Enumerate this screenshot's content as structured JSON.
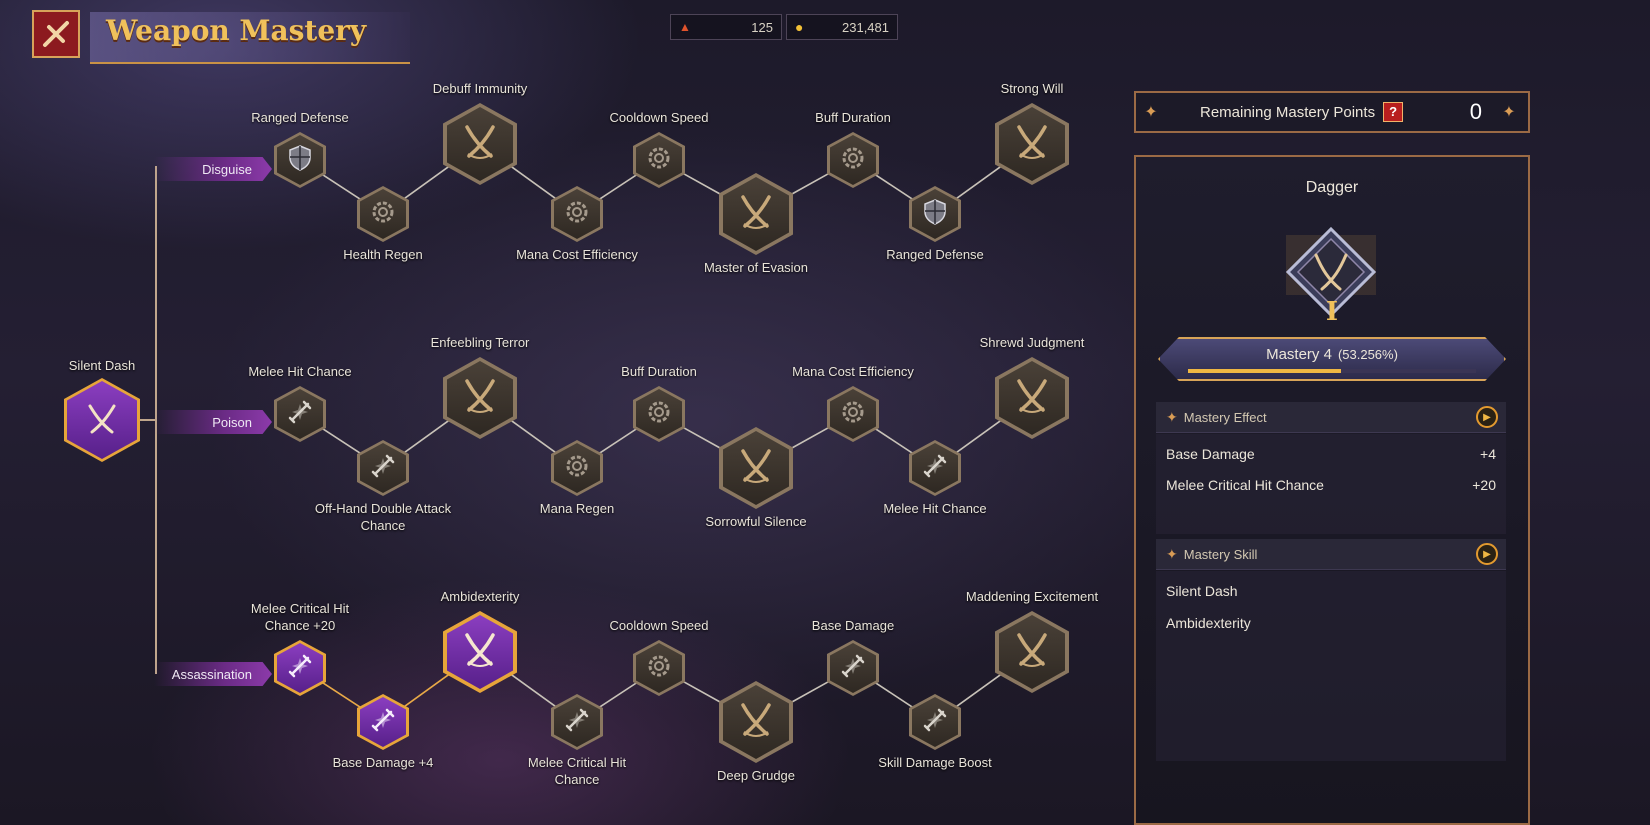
{
  "header": {
    "title": "Weapon Mastery"
  },
  "currencies": [
    {
      "icon": "ticket-icon",
      "value": "125"
    },
    {
      "icon": "gold-coin-icon",
      "value": "231,481"
    }
  ],
  "root": {
    "label": "Silent Dash"
  },
  "branches": [
    {
      "name": "Disguise",
      "nodes": [
        {
          "label": "Ranged Defense",
          "icon": "shield-icon"
        },
        {
          "label": "Health Regen",
          "icon": "gear-icon"
        },
        {
          "label": "Debuff Immunity",
          "icon": "crossed-daggers-icon"
        },
        {
          "label": "Mana Cost Efficiency",
          "icon": "gear-icon"
        },
        {
          "label": "Cooldown Speed",
          "icon": "gear-icon"
        },
        {
          "label": "Master of Evasion",
          "icon": "crossed-daggers-icon"
        },
        {
          "label": "Buff Duration",
          "icon": "gear-icon"
        },
        {
          "label": "Ranged Defense",
          "icon": "shield-icon"
        },
        {
          "label": "Strong Will",
          "icon": "crossed-daggers-icon"
        }
      ]
    },
    {
      "name": "Poison",
      "nodes": [
        {
          "label": "Melee Hit Chance",
          "icon": "sword-icon"
        },
        {
          "label": "Off-Hand Double Attack",
          "label2": "Chance",
          "icon": "sword-icon"
        },
        {
          "label": "Enfeebling Terror",
          "icon": "crossed-daggers-icon"
        },
        {
          "label": "Mana Regen",
          "icon": "gear-icon"
        },
        {
          "label": "Buff Duration",
          "icon": "gear-icon"
        },
        {
          "label": "Sorrowful Silence",
          "icon": "crossed-daggers-icon"
        },
        {
          "label": "Mana Cost Efficiency",
          "icon": "gear-icon"
        },
        {
          "label": "Melee Hit Chance",
          "icon": "sword-icon"
        },
        {
          "label": "Shrewd Judgment",
          "icon": "crossed-daggers-icon"
        }
      ]
    },
    {
      "name": "Assassination",
      "nodes": [
        {
          "label": "Melee Critical Hit",
          "label2": "Chance +20",
          "icon": "sword-icon",
          "active": true
        },
        {
          "label": "Base Damage  +4",
          "icon": "sword-icon",
          "active": true
        },
        {
          "label": "Ambidexterity",
          "icon": "crossed-daggers-icon",
          "active": true
        },
        {
          "label": "Melee Critical Hit",
          "label2": "Chance",
          "icon": "sword-icon"
        },
        {
          "label": "Cooldown Speed",
          "icon": "gear-icon"
        },
        {
          "label": "Deep Grudge",
          "icon": "crossed-daggers-icon"
        },
        {
          "label": "Base Damage",
          "icon": "sword-icon"
        },
        {
          "label": "Skill Damage Boost",
          "icon": "sword-icon"
        },
        {
          "label": "Maddening Excitement",
          "icon": "crossed-daggers-icon"
        }
      ]
    }
  ],
  "panel": {
    "remaining_label": "Remaining Mastery Points",
    "help": "?",
    "remaining_points": "0",
    "weapon": "Dagger",
    "rank": "I",
    "mastery_level": "Mastery 4",
    "mastery_percent": "(53.256%)",
    "mastery_progress": 0.53256,
    "effect_title": "Mastery Effect",
    "effects": [
      {
        "name": "Base Damage",
        "value": "+4"
      },
      {
        "name": "Melee Critical Hit Chance",
        "value": "+20"
      }
    ],
    "skill_title": "Mastery Skill",
    "skills": [
      "Silent Dash",
      "Ambidexterity"
    ]
  },
  "colors": {
    "accent_gold": "#f0b743",
    "active_purple": "#7a34b0",
    "frame_bronze": "#9b6a45"
  }
}
